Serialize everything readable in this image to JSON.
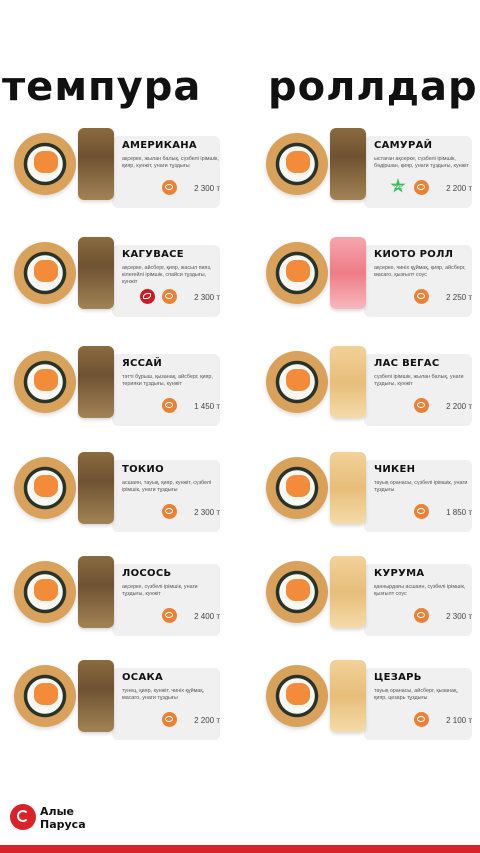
{
  "header": {
    "word1": "темпура",
    "word2": "роллдар"
  },
  "left": [
    {
      "name": "АМЕРИКАНА",
      "desc": "ақсерке, жылан балық, сүзбелі ірімшік, қияр, кунжіт, унаги тұздығы",
      "price": "2 300 т",
      "block": "dark"
    },
    {
      "name": "КАГУВАСЕ",
      "desc": "ақсерке, айсберг, қияр, жасыл пияз, кілегейлі ірімшік, спайси тұздығы, кунжіт",
      "price": "2 300 т",
      "block": "dark",
      "spicy": true
    },
    {
      "name": "ЯССАЙ",
      "desc": "тәтті бұрыш, қызанақ, айсберг, қияр, терияки тұздығы, кунжіт",
      "price": "1 450 т",
      "block": "dark"
    },
    {
      "name": "ТОКИО",
      "desc": "асшаян, тауық, қияр, кунжіт, сүзбелі ірімшік, унаги тұздығы",
      "price": "2 300 т",
      "block": "dark"
    },
    {
      "name": "ЛОСОСЬ",
      "desc": "ақсерке, сүзбелі ірімшік, унаги тұздығы, кунжіт",
      "price": "2 400 т",
      "block": "dark"
    },
    {
      "name": "ОСАКА",
      "desc": "тунец, қияр, кунжіт, чиніх құймақ, масаго, унаги тұздығы",
      "price": "2 200 т",
      "block": "dark"
    }
  ],
  "right": [
    {
      "name": "САМУРАЙ",
      "desc": "ыстаған ақсерке, сүзбелі ірімшік, бәдіршан, қияр, унаги тұздығы, кунжіт",
      "price": "2 200 т",
      "block": "dark",
      "star": "ХИТ"
    },
    {
      "name": "КИОТО РОЛЛ",
      "desc": "ақсерке, чиніх құймақ, қияр, айсберг, масаго, қызғылт соус",
      "price": "2 250 т",
      "block": "pink"
    },
    {
      "name": "ЛАС ВЕГАС",
      "desc": "сүзбелі ірімшік, жылан балық, унаги тұздығы, кунжіт",
      "price": "2 200 т",
      "block": "light"
    },
    {
      "name": "ЧИКЕН",
      "desc": "тауық оранасы, сүзбелі ірімшік, унаги тұздығы",
      "price": "1 850 т",
      "block": "light"
    },
    {
      "name": "КУРУМА",
      "desc": "қаннырдағы асшаян, сүзбелі ірімшік, қызғылт соус",
      "price": "2 300 т",
      "block": "light"
    },
    {
      "name": "ЦЕЗАРЬ",
      "desc": "тауық оранасы, айсберг, қызанақ, қияр, цезарь тұздығы",
      "price": "2 100 т",
      "block": "light"
    }
  ],
  "brand": {
    "line1": "Алые",
    "line2": "Паруса"
  },
  "colors": {
    "accent": "#e98236",
    "brand": "#d8232a",
    "panel": "#f0f0f0"
  }
}
